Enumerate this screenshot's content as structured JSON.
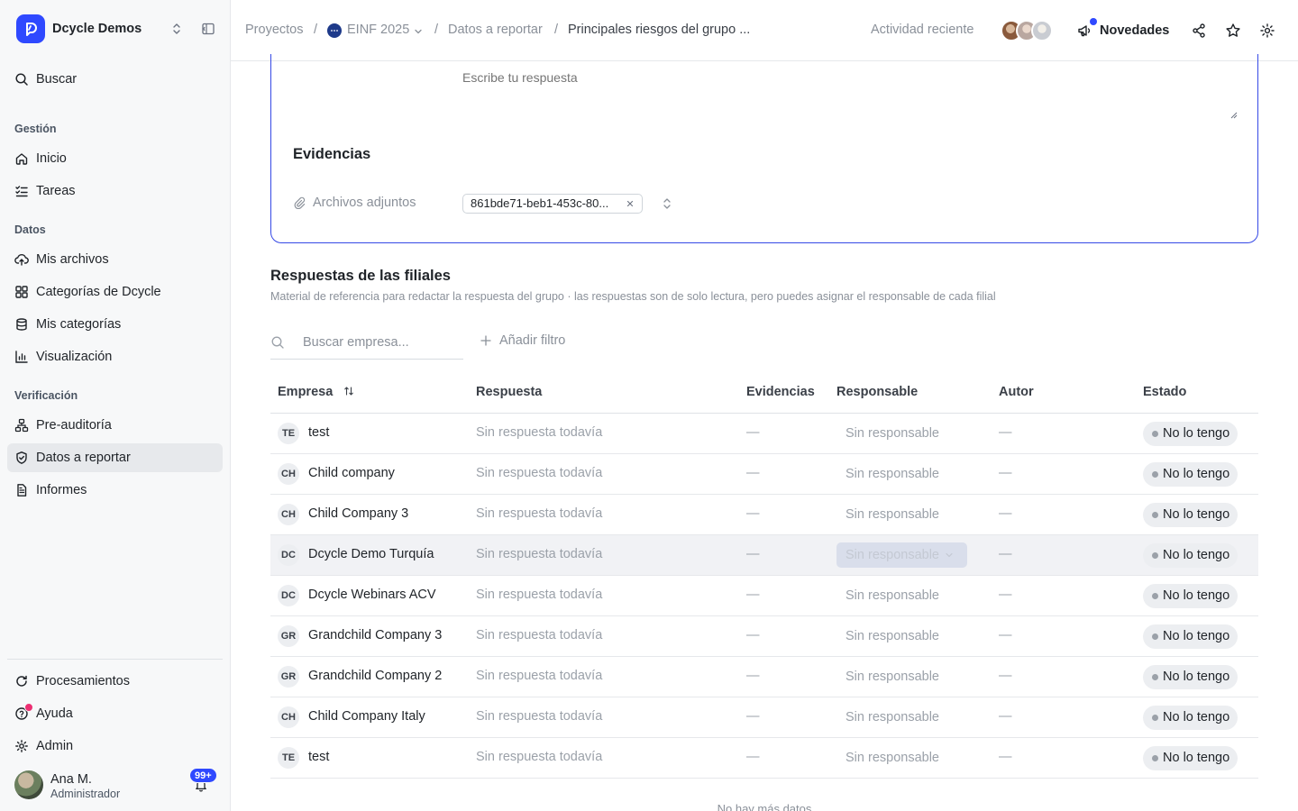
{
  "workspace": {
    "name": "Dcycle Demos"
  },
  "sidebar": {
    "search_label": "Buscar",
    "sections": {
      "gestion": "Gestión",
      "datos": "Datos",
      "verificacion": "Verificación"
    },
    "items": {
      "inicio": "Inicio",
      "tareas": "Tareas",
      "mis_archivos": "Mis archivos",
      "categorias_dcycle": "Categorías de Dcycle",
      "mis_categorias": "Mis categorías",
      "visualizacion": "Visualización",
      "pre_auditoria": "Pre-auditoría",
      "datos_reportar": "Datos a reportar",
      "informes": "Informes"
    },
    "bottom": {
      "procesamientos": "Procesamientos",
      "ayuda": "Ayuda",
      "admin": "Admin"
    },
    "active_item": "datos_reportar"
  },
  "user": {
    "name": "Ana M.",
    "role": "Administrador",
    "notifications": "99+"
  },
  "breadcrumb": {
    "proyectos": "Proyectos",
    "project": "EINF 2025",
    "datos": "Datos a reportar",
    "current": "Principales riesgos del grupo ..."
  },
  "topbar": {
    "recent_activity": "Actividad reciente",
    "news_label": "Novedades"
  },
  "form": {
    "answer_placeholder": "Escribe tu respuesta",
    "evidences_title": "Evidencias",
    "attachments_label": "Archivos adjuntos",
    "attachment_file": "861bde71-beb1-453c-80..."
  },
  "subsidiaries": {
    "title": "Respuestas de las filiales",
    "subtitle": "Material de referencia para redactar la respuesta del grupo · las respuestas son de solo lectura, pero puedes asignar el responsable de cada filial",
    "search_placeholder": "Buscar empresa...",
    "add_filter": "Añadir filtro",
    "columns": {
      "empresa": "Empresa",
      "respuesta": "Respuesta",
      "evidencias": "Evidencias",
      "responsable": "Responsable",
      "autor": "Autor",
      "estado": "Estado"
    },
    "rows": [
      {
        "tag": "TE",
        "name": "test",
        "answer": "Sin respuesta todavía",
        "evidences": "—",
        "owner": "Sin responsable",
        "author": "—",
        "status": "No lo tengo"
      },
      {
        "tag": "CH",
        "name": "Child company",
        "answer": "Sin respuesta todavía",
        "evidences": "—",
        "owner": "Sin responsable",
        "author": "—",
        "status": "No lo tengo"
      },
      {
        "tag": "CH",
        "name": "Child Company 3",
        "answer": "Sin respuesta todavía",
        "evidences": "—",
        "owner": "Sin responsable",
        "author": "—",
        "status": "No lo tengo"
      },
      {
        "tag": "DC",
        "name": "Dcycle Demo Turquía",
        "answer": "Sin respuesta todavía",
        "evidences": "—",
        "owner": "Sin responsable",
        "author": "—",
        "status": "No lo tengo"
      },
      {
        "tag": "DC",
        "name": "Dcycle Webinars ACV",
        "answer": "Sin respuesta todavía",
        "evidences": "—",
        "owner": "Sin responsable",
        "author": "—",
        "status": "No lo tengo"
      },
      {
        "tag": "GR",
        "name": "Grandchild Company 3",
        "answer": "Sin respuesta todavía",
        "evidences": "—",
        "owner": "Sin responsable",
        "author": "—",
        "status": "No lo tengo"
      },
      {
        "tag": "GR",
        "name": "Grandchild Company 2",
        "answer": "Sin respuesta todavía",
        "evidences": "—",
        "owner": "Sin responsable",
        "author": "—",
        "status": "No lo tengo"
      },
      {
        "tag": "CH",
        "name": "Child Company Italy",
        "answer": "Sin respuesta todavía",
        "evidences": "—",
        "owner": "Sin responsable",
        "author": "—",
        "status": "No lo tengo"
      },
      {
        "tag": "TE",
        "name": "test",
        "answer": "Sin respuesta todavía",
        "evidences": "—",
        "owner": "Sin responsable",
        "author": "—",
        "status": "No lo tengo"
      }
    ],
    "end_note": "No hay más datos"
  },
  "colors": {
    "accent": "#2f49ff",
    "card_border": "#3549e6",
    "help_dot": "#ec2f72"
  }
}
